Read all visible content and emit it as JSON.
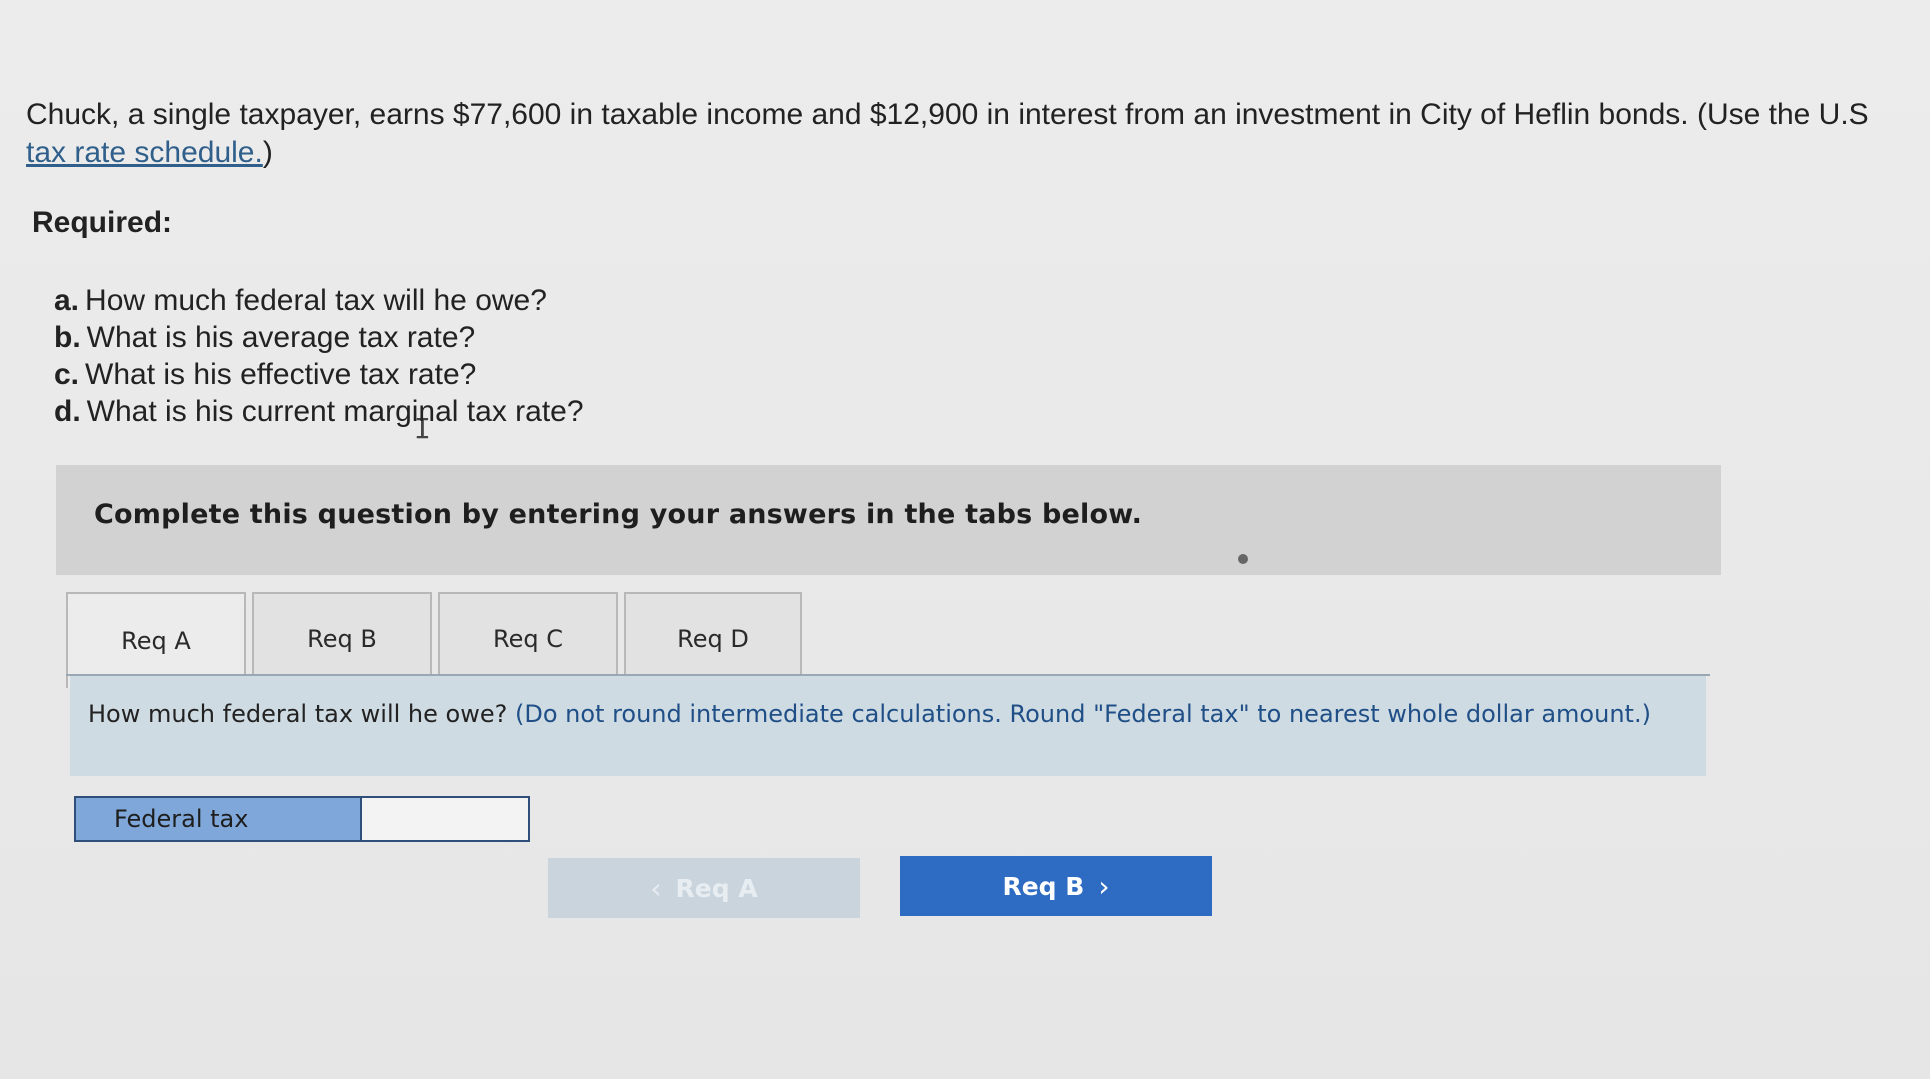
{
  "question": {
    "text_main": "Chuck, a single taxpayer, earns $77,600 in taxable income and $12,900 in interest from an investment in City of Heflin bonds. (Use the U.S ",
    "link_text": "tax rate schedule.",
    "text_after_link": ")"
  },
  "required_label": "Required:",
  "requirements": [
    {
      "letter": "a.",
      "text": "How much federal tax will he owe?"
    },
    {
      "letter": "b.",
      "text": "What is his average tax rate?"
    },
    {
      "letter": "c.",
      "text": "What is his effective tax rate?"
    },
    {
      "letter": "d.",
      "text": "What is his current marginal tax rate?"
    }
  ],
  "instruction": "Complete this question by entering your answers in the tabs below.",
  "tabs": [
    {
      "label": "Req A",
      "active": true
    },
    {
      "label": "Req B",
      "active": false
    },
    {
      "label": "Req C",
      "active": false
    },
    {
      "label": "Req D",
      "active": false
    }
  ],
  "panel": {
    "question": "How much federal tax will he owe?",
    "note": "(Do not round intermediate calculations. Round \"Federal tax\" to nearest whole dollar amount.)"
  },
  "answer": {
    "label": "Federal tax",
    "value": ""
  },
  "nav": {
    "prev_label": "Req A",
    "next_label": "Req B",
    "prev_chevron": "‹",
    "next_chevron": "›"
  }
}
